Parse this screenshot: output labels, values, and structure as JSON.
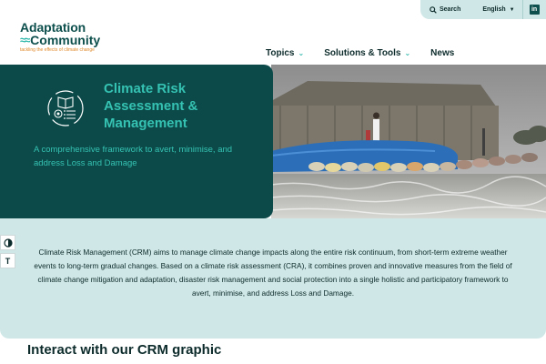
{
  "utility": {
    "search_label": "Search",
    "language_label": "English",
    "linkedin_label": "in"
  },
  "logo": {
    "line1": "Adaptation",
    "line2": "Community",
    "tagline": "tackling the effects of climate change"
  },
  "nav": {
    "items": [
      {
        "label": "Topics",
        "has_dropdown": true
      },
      {
        "label": "Solutions & Tools",
        "has_dropdown": true
      },
      {
        "label": "News",
        "has_dropdown": false
      }
    ]
  },
  "hero": {
    "title": "Climate Risk Assessment & Management",
    "subtitle": "A comprehensive framework to avert, minimise, and address Loss and Damage",
    "icon": "crm-cycle-icon"
  },
  "intro": {
    "text": "Climate Risk Management (CRM) aims to manage climate change impacts along the entire risk continuum, from short-term extreme weather events to long-term gradual changes. Based on a climate risk assessment (CRA), it combines proven and innovative measures from the field of climate change mitigation and adaptation, disaster risk management and social protection into a single holistic and participatory framework to avert, minimise, and address Loss and Damage."
  },
  "side_tools": {
    "contrast_icon": "contrast-icon",
    "font_size_icon": "font-size-icon",
    "font_size_glyph": "T"
  },
  "section": {
    "title": "Interact with our CRM graphic"
  },
  "colors": {
    "dark_teal": "#0c4a49",
    "accent_teal": "#35c2b2",
    "light_teal": "#cfe7e6",
    "tagline_orange": "#e08a2c"
  }
}
